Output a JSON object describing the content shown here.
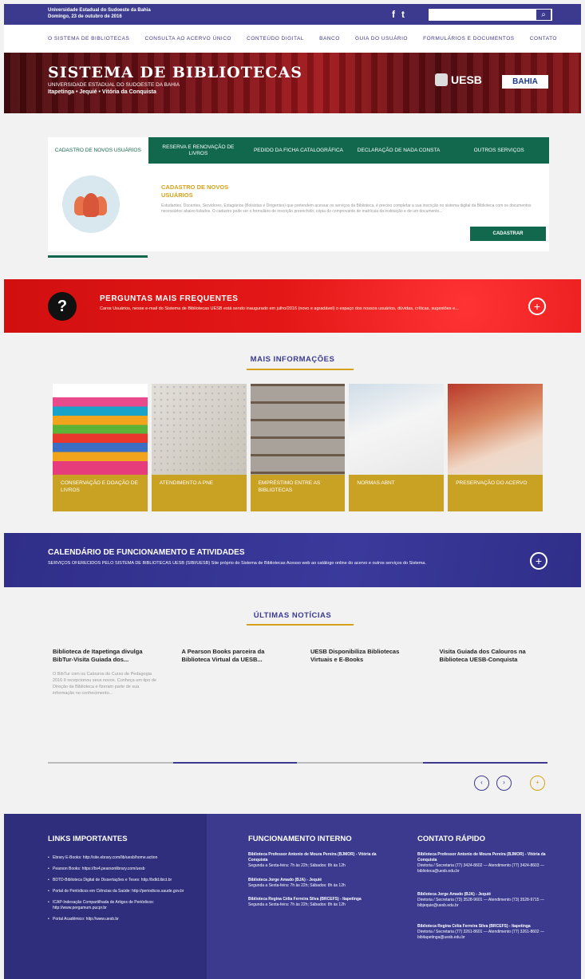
{
  "topbar": {
    "institution": "Universidade Estadual do Sudoeste da Bahia",
    "date": "Domingo, 23 de outubro de 2016",
    "social": [
      "f",
      "t"
    ],
    "search_placeholder": "",
    "search_button": "⌕"
  },
  "nav": [
    "O SISTEMA DE BIBLIOTECAS",
    "CONSULTA AO ACERVO ÚNICO",
    "CONTEÚDO DIGITAL",
    "BANCO",
    "GUIA DO USUÁRIO",
    "FORMULÁRIOS E DOCUMENTOS",
    "CONTATO"
  ],
  "banner": {
    "title": "SISTEMA DE BIBLIOTECAS",
    "subtitle": "UNIVERSIDADE ESTADUAL DO SUDOESTE DA BAHIA",
    "campuses": "Itapetinga • Jequié • Vitória da Conquista",
    "logo_uesb": "UESB",
    "logo_bahia": "BAHIA"
  },
  "tabs": [
    "CADASTRO DE NOVOS USUÁRIOS",
    "RESERVA E RENOVAÇÃO DE LIVROS",
    "PEDIDO DA FICHA CATALOGRÁFICA",
    "DECLARAÇÃO DE NADA CONSTA",
    "OUTROS SERVIÇOS"
  ],
  "tab_panel": {
    "heading": "CADASTRO DE NOVOS USUÁRIOS",
    "description": "Estudantes, Docentes, Servidores, Estagiários (Bolsistas e Dirigentes) que pretendem acessar os serviços da Biblioteca, é preciso completar a sua inscrição no sistema digital da Biblioteca com os documentos necessários abaixo listados. O cadastro pode ser o formulário de inscrição preenchido, cópia do comprovante de matrícula da instituição e de um documento...",
    "button": "CADASTRAR"
  },
  "faq": {
    "title": "PERGUNTAS MAIS FREQUENTES",
    "text": "Caros Usuários, nesse e-mail do Sistema de Bibliotecas UESB está sendo inaugurado em julho/2016 (novo e agradável) o espaço dos nossos usuários, dúvidas, críticas, sugestões e...",
    "icon": "?",
    "plus": "+"
  },
  "more_info": {
    "title": "MAIS INFORMAÇÕES",
    "cards": [
      "CONSERVAÇÃO E DOAÇÃO DE LIVROS",
      "ATENDIMENTO A PNE",
      "EMPRÉSTIMO ENTRE AS BIBLIOTECAS",
      "NORMAS ABNT",
      "PRESERVAÇÃO DO ACERVO"
    ]
  },
  "calendar": {
    "title": "CALENDÁRIO DE FUNCIONAMENTO E ATIVIDADES",
    "text": "SERVIÇOS OFERECIDOS PELO SISTEMA DE BIBLIOTECAS UESB (SIBI/UESB) Site próprio do Sistema de Bibliotecas Acesso web ao catálogo online do acervo e outros serviços do Sistema.",
    "plus": "+"
  },
  "news": {
    "title": "ÚLTIMAS NOTÍCIAS",
    "items": [
      {
        "title": "Biblioteca de Itapetinga divulga BibTur-Visita Guiada dos...",
        "excerpt": "O BibTur com os Calouros do Curso de Pedagogia 2016 II recepcionou seus novos. Conheça um tipo de Direção da Biblioteca e fizeram parte de sua informação no conhecimento..."
      },
      {
        "title": "A Pearson Books parceira da Biblioteca Virtual da UESB...",
        "excerpt": ""
      },
      {
        "title": "UESB Disponibiliza Bibliotecas Virtuais e E-Books",
        "excerpt": ""
      },
      {
        "title": "Visita Guiada dos Calouros na Biblioteca UESB-Conquista",
        "excerpt": ""
      }
    ],
    "controls": [
      "‹",
      "›",
      "+"
    ]
  },
  "footer": {
    "links_title": "LINKS IMPORTANTES",
    "links": [
      "Ebrary E-Books: http://site.ebrary.com/lib/uesb/home.action",
      "Pearson Books: https://bv4.pearsonlibrary.com/uesb",
      "BDTD-Biblioteca Digital de Dissertações e Teses: http://bdtd.ibict.br",
      "Portal de Periódicos em Ciências da Saúde: http://periodicos.saude.gov.br",
      "ICAP-Indexação Compartilhada de Artigos de Periódicos: http://www.pergamum.pucpr.br",
      "Portal Acadêmico: http://www.uesb.br"
    ],
    "hours_title": "FUNCIONAMENTO INTERNO",
    "hours": [
      {
        "name": "Biblioteca Professor Antonio de Moura Pereira (BJMOR) - Vitória da Conquista",
        "text": "Segunda a Sexta-feira: 7h às 22h; Sábados: 8h às 12h"
      },
      {
        "name": "Biblioteca Jorge Amado (BJA) - Jequié",
        "text": "Segunda a Sexta-feira: 7h às 22h; Sábados: 8h às 12h"
      },
      {
        "name": "Biblioteca Regina Célia Ferreira Silva (BRCEFS) - Itapetinga",
        "text": "Segunda a Sexta-feira: 7h às 22h; Sábados: 8h às 12h"
      }
    ],
    "contact_title": "CONTATO RÁPIDO",
    "contacts": [
      {
        "name": "Biblioteca Professor Antonio de Moura Pereira (BJMOR) - Vitória da Conquista",
        "text": "Diretoria / Secretaria (77) 3424-8602 — Atendimento (77) 3424-8603 — biblioteca@uesb.edu.br"
      },
      {
        "name": "Biblioteca Jorge Amado (BJA) - Jequié",
        "text": "Diretoria / Secretaria (73) 3528-9601 — Atendimento (73) 3528-9715 — bibjequie@uesb.edu.br"
      },
      {
        "name": "Biblioteca Regina Célia Ferreira Silva (BRCEFS) - Itapetinga",
        "text": "Diretoria / Secretaria (77) 3261-8601 — Atendimento (77) 3261-8602 — bibitapetinga@uesb.edu.br"
      }
    ]
  }
}
